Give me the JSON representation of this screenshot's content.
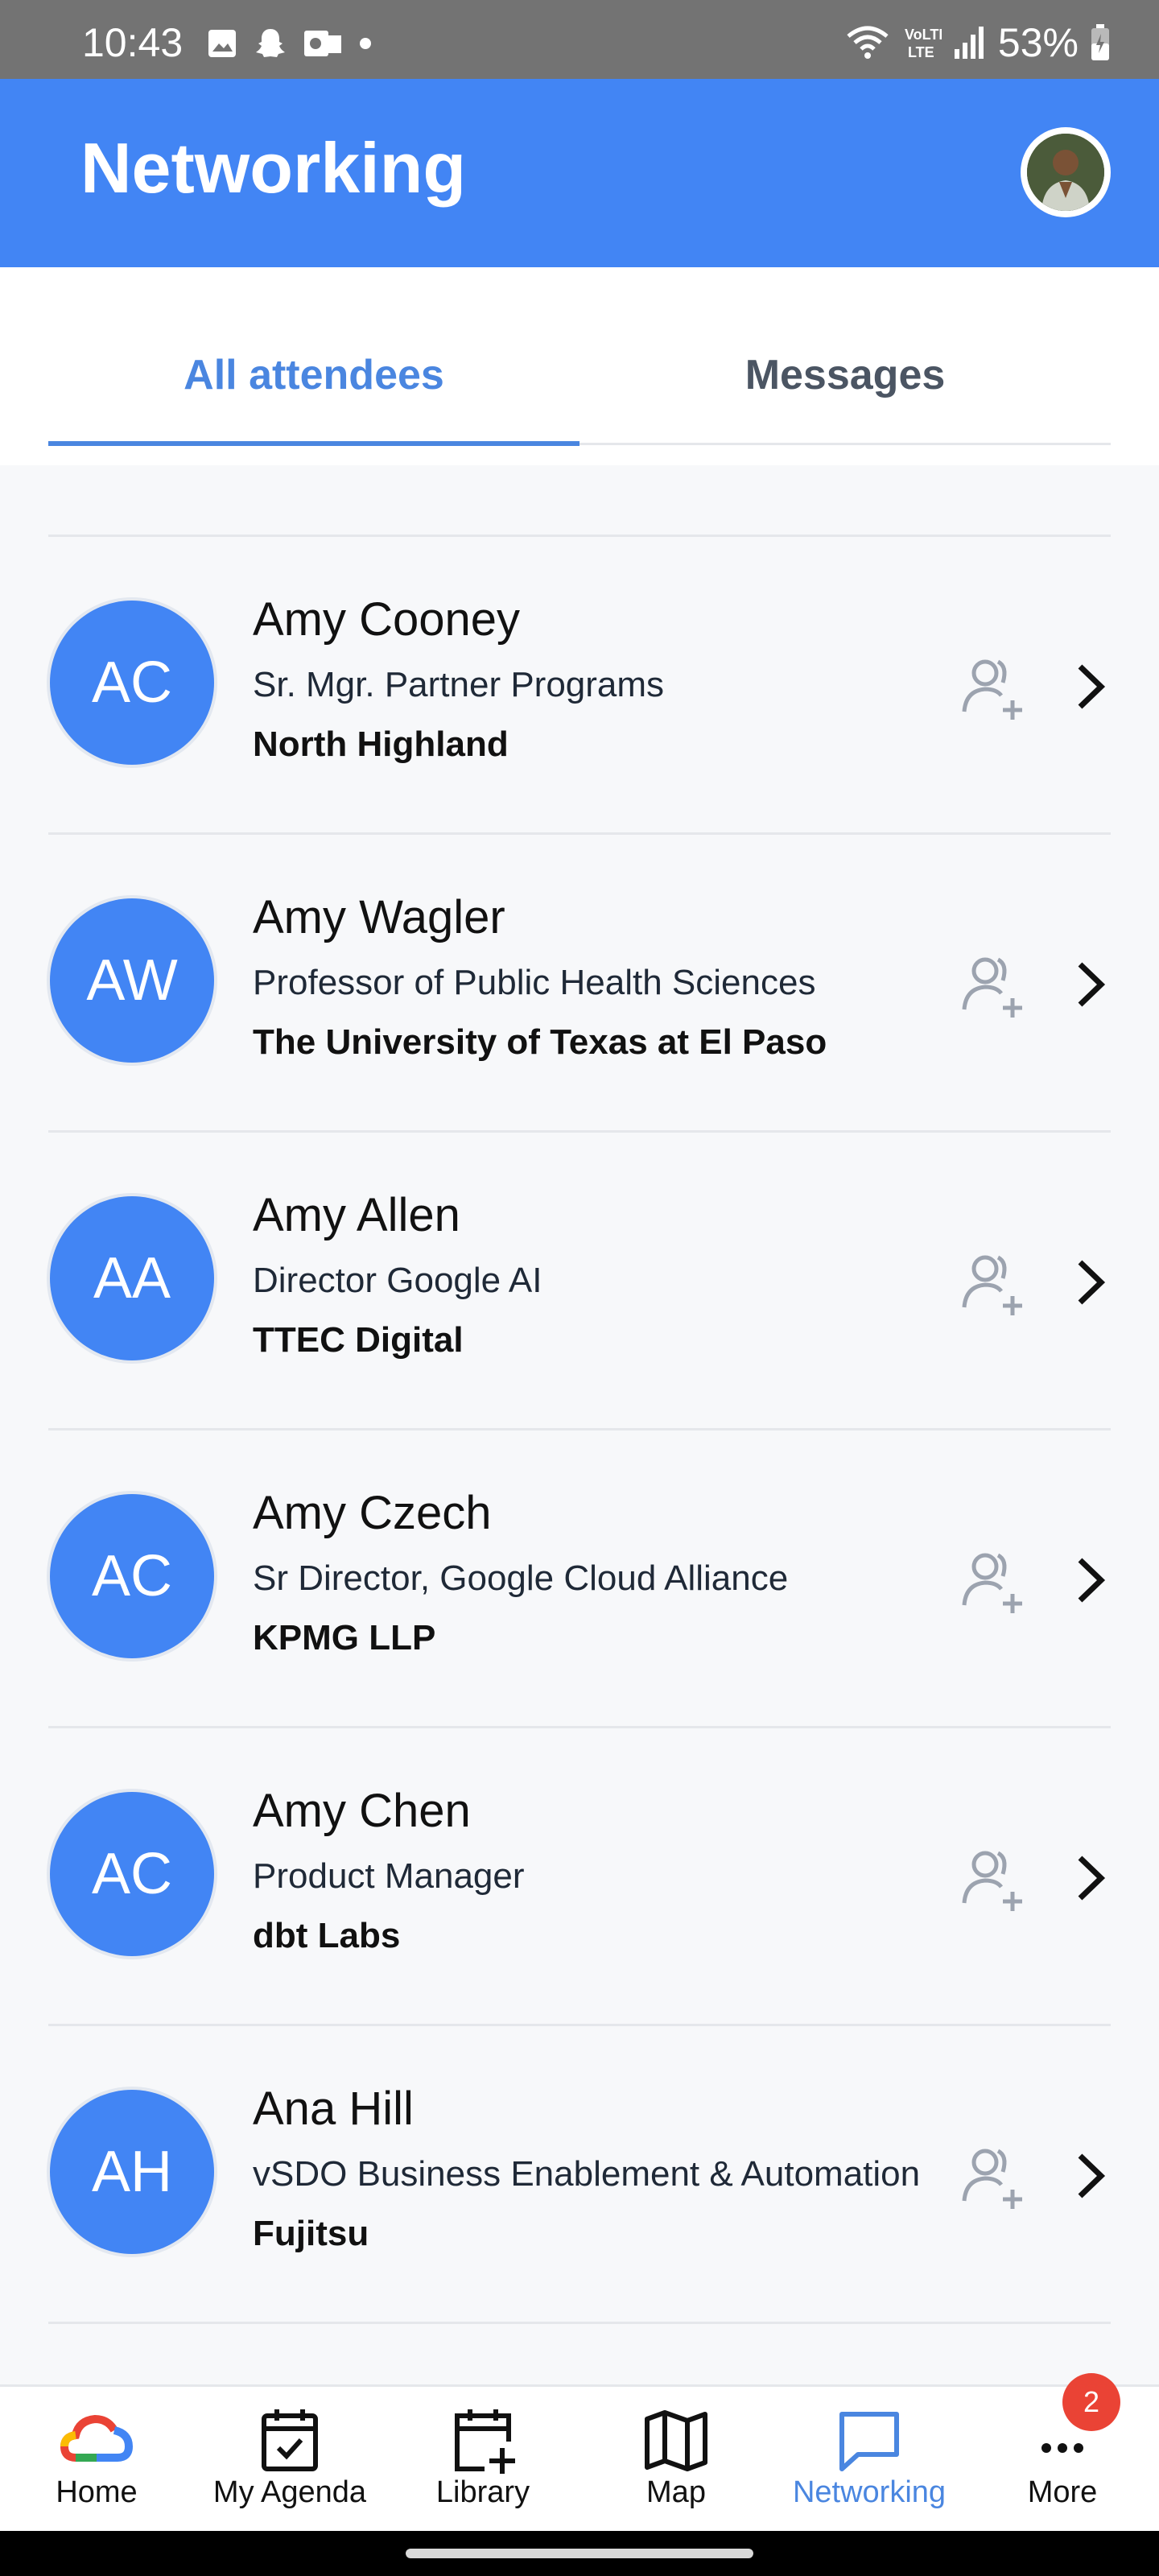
{
  "status_bar": {
    "time": "10:43",
    "battery": "53%"
  },
  "app_bar": {
    "title": "Networking"
  },
  "tabs": {
    "all": "All attendees",
    "messages": "Messages"
  },
  "attendees": [
    {
      "initials": "AC",
      "name": "Amy Cooney",
      "role": "Sr. Mgr. Partner Programs",
      "org": "North Highland"
    },
    {
      "initials": "AW",
      "name": "Amy Wagler",
      "role": "Professor of Public Health Sciences",
      "org": "The University of Texas at El Paso"
    },
    {
      "initials": "AA",
      "name": "Amy Allen",
      "role": "Director Google AI",
      "org": "TTEC Digital"
    },
    {
      "initials": "AC",
      "name": "Amy Czech",
      "role": "Sr Director, Google Cloud Alliance",
      "org": "KPMG LLP"
    },
    {
      "initials": "AC",
      "name": "Amy Chen",
      "role": "Product Manager",
      "org": "dbt Labs"
    },
    {
      "initials": "AH",
      "name": "Ana Hill",
      "role": "vSDO Business Enablement & Automation",
      "org": "Fujitsu"
    }
  ],
  "bottom_nav": {
    "home": "Home",
    "agenda": "My Agenda",
    "library": "Library",
    "map": "Map",
    "networking": "Networking",
    "more": "More",
    "more_badge": "2"
  },
  "colors": {
    "primary": "#4285f4",
    "accent": "#4a86e0",
    "badge": "#ea4335"
  }
}
